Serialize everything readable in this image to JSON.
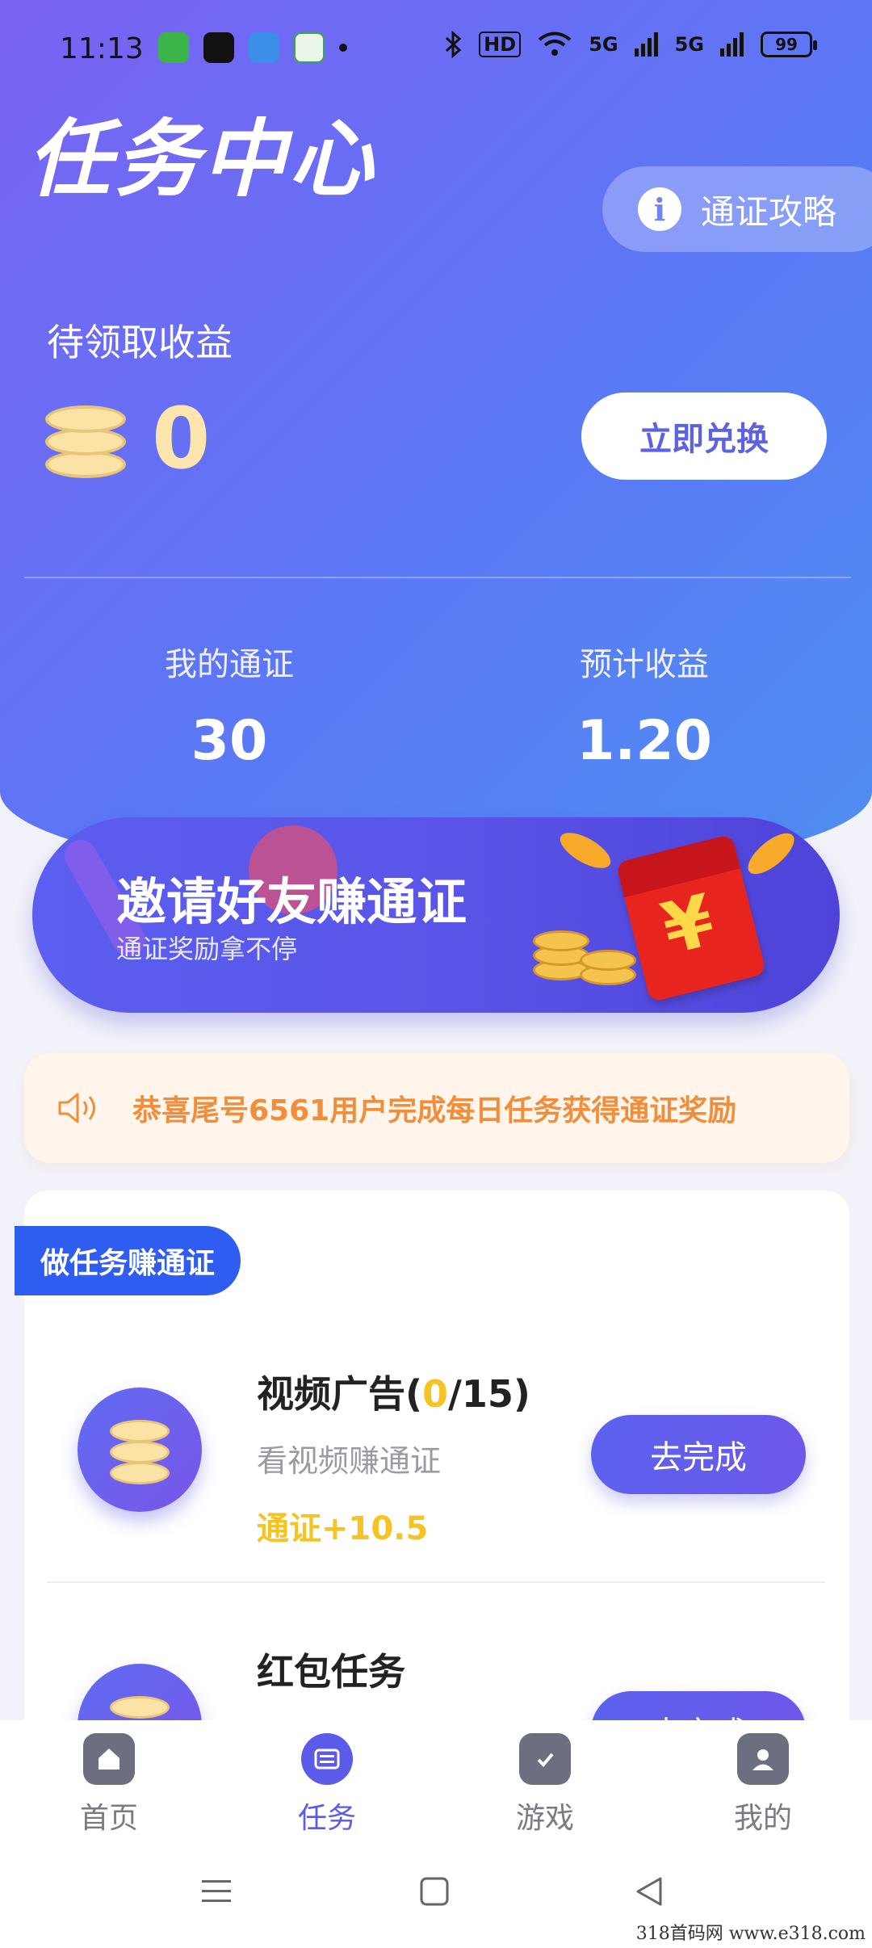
{
  "status_bar": {
    "time": "11:13",
    "indicators": [
      "HD",
      "5G",
      "5G"
    ],
    "battery": "99",
    "icons": [
      "bluetooth-icon",
      "wifi-icon",
      "signal-icon",
      "signal-icon"
    ]
  },
  "header": {
    "title": "任务中心",
    "guide_label": "通证攻略"
  },
  "earnings": {
    "pending_label": "待领取收益",
    "pending_value": "0",
    "redeem_label": "立即兑换",
    "stats": [
      {
        "label": "我的通证",
        "value": "30"
      },
      {
        "label": "预计收益",
        "value": "1.20"
      }
    ]
  },
  "invite_banner": {
    "title": "邀请好友赚通证",
    "subtitle": "通证奖励拿不停",
    "badge": "¥"
  },
  "notice": {
    "text": "恭喜尾号6561用户完成每日任务获得通证奖励"
  },
  "tasks": {
    "section_label": "做任务赚通证",
    "items": [
      {
        "name": "视频广告",
        "progress_open": "(",
        "progress_done": "0",
        "progress_total": "/15)",
        "desc": "看视频赚通证",
        "reward": "通证+10.5",
        "action": "去完成"
      },
      {
        "name": "红包任务",
        "action": "去完成"
      }
    ]
  },
  "bottom_nav": [
    {
      "label": "首页",
      "active": false
    },
    {
      "label": "任务",
      "active": true
    },
    {
      "label": "游戏",
      "active": false
    },
    {
      "label": "我的",
      "active": false
    }
  ],
  "watermark": "318首码网  www.e318.com",
  "colors": {
    "accent": "#5a5be8",
    "hero_start": "#7a62f2",
    "hero_end": "#4f8ff2",
    "reward": "#f5c422",
    "notice": "#f18e3c",
    "tag": "#2f5df2"
  }
}
